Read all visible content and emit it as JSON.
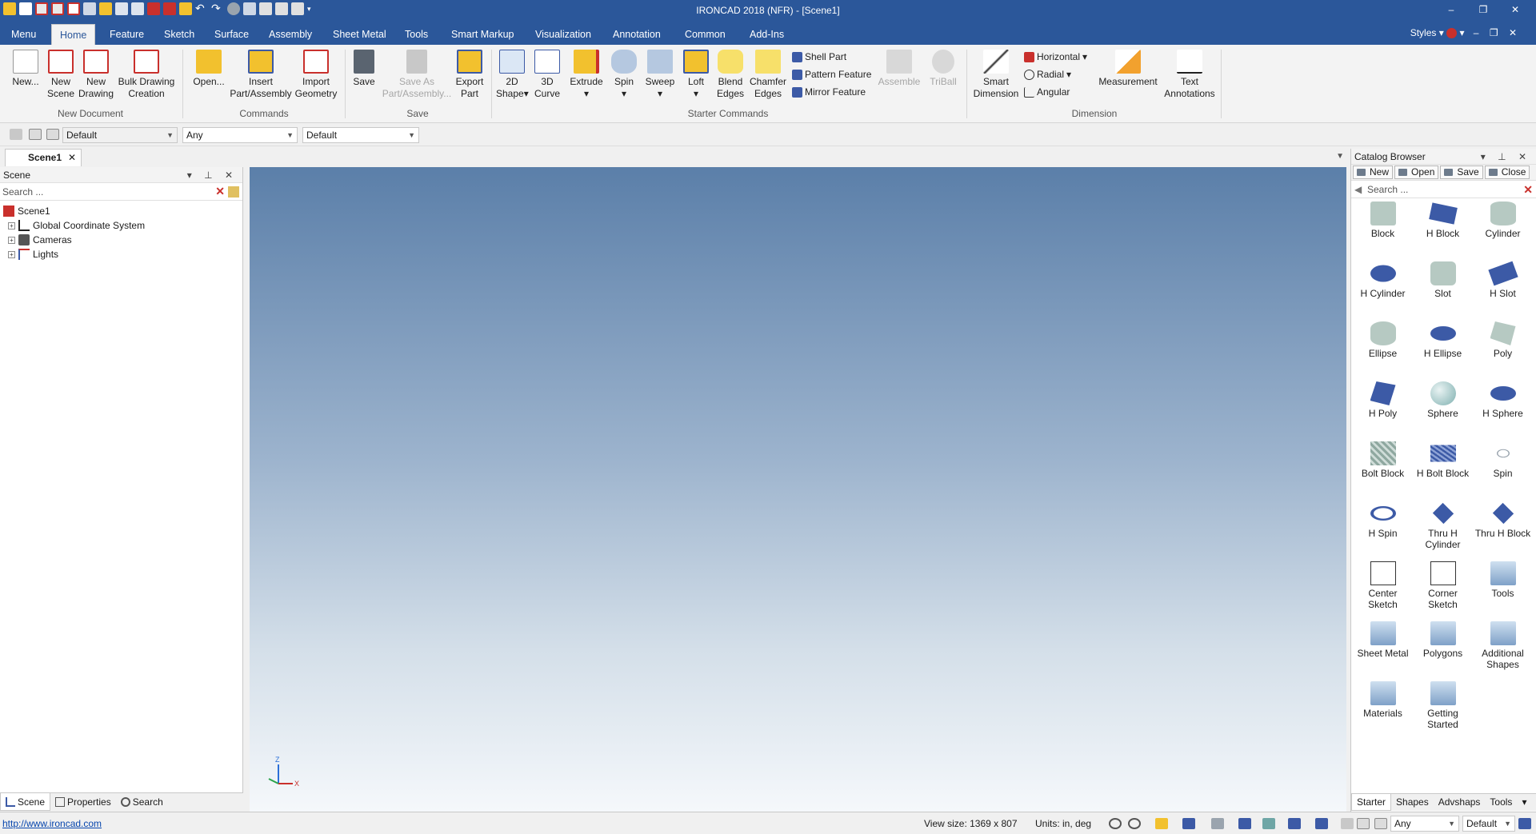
{
  "window": {
    "title": "IRONCAD 2018 (NFR) - [Scene1]",
    "controls": [
      "–",
      "❐",
      "✕"
    ],
    "inner_controls": [
      "–",
      "❐",
      "✕"
    ]
  },
  "colors": {
    "title_blue": "#2b579a",
    "red_icon": "#c9302c",
    "blue_icon": "#3c5aa6",
    "yellow_icon": "#f2c12e",
    "gray_icon": "#9aa4ae",
    "teal_icon": "#6fa6a6"
  },
  "tabs": [
    "Menu",
    "Home",
    "Feature",
    "Sketch",
    "Surface",
    "Assembly",
    "Sheet Metal",
    "Tools",
    "Smart Markup",
    "Visualization",
    "Annotation",
    "Common",
    "Add-Ins"
  ],
  "active_tab": "Home",
  "styles_label": "Styles",
  "ribbon": {
    "new_document": {
      "label": "New Document",
      "new": "New...",
      "new_scene": [
        "New",
        "Scene"
      ],
      "new_drawing": [
        "New",
        "Drawing"
      ],
      "bulk_drawing": [
        "Bulk Drawing",
        "Creation"
      ]
    },
    "commands": {
      "label": "Commands",
      "open": "Open...",
      "insert": [
        "Insert",
        "Part/Assembly"
      ],
      "import": [
        "Import",
        "Geometry"
      ]
    },
    "save": {
      "label": "Save",
      "save": "Save",
      "save_as": [
        "Save As",
        "Part/Assembly..."
      ],
      "export": [
        "Export",
        "Part"
      ]
    },
    "starter": {
      "label": "Starter Commands",
      "shape2d": [
        "2D",
        "Shape"
      ],
      "curve3d": [
        "3D",
        "Curve"
      ],
      "extrude": "Extrude",
      "spin": "Spin",
      "sweep": "Sweep",
      "loft": "Loft",
      "blend": [
        "Blend",
        "Edges"
      ],
      "chamfer": [
        "Chamfer",
        "Edges"
      ],
      "shell": "Shell Part",
      "pattern": "Pattern Feature",
      "mirror": "Mirror Feature",
      "assemble": "Assemble",
      "triball": "TriBall"
    },
    "dimension": {
      "label": "Dimension",
      "smart": [
        "Smart",
        "Dimension"
      ],
      "horizontal": "Horizontal",
      "radial": "Radial",
      "angular": "Angular",
      "measurement": "Measurement",
      "text": [
        "Text",
        "Annotations"
      ]
    }
  },
  "toolbar2": {
    "combo1": "Default",
    "combo2": "Any",
    "combo3": "Default"
  },
  "doc_tab": {
    "label": "Scene1",
    "close": "✕"
  },
  "scene_panel": {
    "title": "Scene",
    "search_placeholder": "Search ...",
    "tree": {
      "root": "Scene1",
      "children": [
        "Global Coordinate System",
        "Cameras",
        "Lights"
      ]
    }
  },
  "bottom_tabs": [
    "Scene",
    "Properties",
    "Search"
  ],
  "triad": {
    "z": "Z",
    "x": "X"
  },
  "catalog": {
    "title": "Catalog Browser",
    "buttons": [
      "New",
      "Open",
      "Save",
      "Close"
    ],
    "search_placeholder": "Search ...",
    "items": [
      {
        "label": "Block",
        "icon": "block-icon"
      },
      {
        "label": "H Block",
        "icon": "h-block-icon"
      },
      {
        "label": "Cylinder",
        "icon": "cylinder-icon"
      },
      {
        "label": "H Cylinder",
        "icon": "h-cylinder-icon"
      },
      {
        "label": "Slot",
        "icon": "slot-icon"
      },
      {
        "label": "H Slot",
        "icon": "h-slot-icon"
      },
      {
        "label": "Ellipse",
        "icon": "ellipse-icon"
      },
      {
        "label": "H Ellipse",
        "icon": "h-ellipse-icon"
      },
      {
        "label": "Poly",
        "icon": "poly-icon"
      },
      {
        "label": "H Poly",
        "icon": "h-poly-icon"
      },
      {
        "label": "Sphere",
        "icon": "sphere-icon"
      },
      {
        "label": "H Sphere",
        "icon": "h-sphere-icon"
      },
      {
        "label": "Bolt Block",
        "icon": "bolt-block-icon"
      },
      {
        "label": "H Bolt Block",
        "icon": "h-bolt-block-icon"
      },
      {
        "label": "Spin",
        "icon": "spin-icon"
      },
      {
        "label": "H Spin",
        "icon": "h-spin-icon"
      },
      {
        "label": "Thru H Cylinder",
        "icon": "thru-h-cylinder-icon"
      },
      {
        "label": "Thru H Block",
        "icon": "thru-h-block-icon"
      },
      {
        "label": "Center Sketch",
        "icon": "center-sketch-icon"
      },
      {
        "label": "Corner Sketch",
        "icon": "corner-sketch-icon"
      },
      {
        "label": "Tools",
        "icon": "folder-icon"
      },
      {
        "label": "Sheet Metal",
        "icon": "folder-icon"
      },
      {
        "label": "Polygons",
        "icon": "folder-icon"
      },
      {
        "label": "Additional Shapes",
        "icon": "folder-icon"
      },
      {
        "label": "Materials",
        "icon": "folder-icon"
      },
      {
        "label": "Getting Started",
        "icon": "folder-icon"
      }
    ],
    "tabs": [
      "Starter",
      "Shapes",
      "Advshaps",
      "Tools"
    ]
  },
  "status": {
    "link": "http://www.ironcad.com",
    "view_size": "View size: 1369 x 807",
    "units": "Units: in, deg",
    "combo_any": "Any",
    "combo_default": "Default"
  }
}
